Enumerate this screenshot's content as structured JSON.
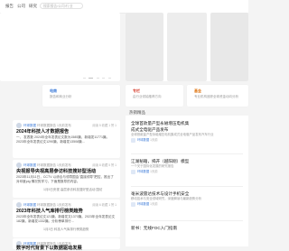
{
  "nav": {
    "items": [
      "报告",
      "公司",
      "研究"
    ],
    "search_placeholder": "搜索报告/公司/行业"
  },
  "banner": {
    "dots": 5,
    "active_dot": 1
  },
  "cards": [
    {
      "tag": "电商",
      "sub": "报告和商业分析",
      "color": "#3b7ad8",
      "sub_color": "#999999"
    },
    {
      "tag": "专栏",
      "sub": "由行业领袖推荐方向",
      "color": "#d84a3a",
      "sub_color": "#999999"
    },
    {
      "tag": "基金",
      "sub": "专业机构追踪全球资金动向分析",
      "color": "#e07a1a",
      "sub_color": "#999999"
    }
  ],
  "left_section": {
    "title": ""
  },
  "feed": [
    {
      "source": "环球数据",
      "meta": "环球数据报告 1天前发布",
      "stats": "阅读 5  收藏 1  赞 1",
      "title": "2024年科技人才数据报告",
      "summary": "一、 发表数 2024年全年发表论文数为1585篇，新增发11771篇。2023年全年发表论文1290篇，新增发13508篇...",
      "extra": ""
    },
    {
      "source": "环球数据",
      "meta": "环球数据报告 1天前发布",
      "stats": "阅读 8  收藏 5  赞 1",
      "title": "央视报导央视高层参访科技搜好型活动",
      "summary": "2023年11月11日，CCTV 以综合与领导国会\"直接领导\"把控，推出了对印度pig 情况的学习，下面是报导的内容。",
      "extra": "1月5日央视 高层参访科技搜好型活动 国访"
    },
    {
      "source": "环球数据",
      "meta": "环球数据报告 1天前发布",
      "stats": "阅读 6  收藏 1  赞 1",
      "title": "2023年科技人气库排行榜类趋势",
      "summary": "2023年全年发表论文121篇，新增发文1370篇。2023年全年发表论文182篇，新增发1332篇。分析榜单排行...",
      "extra": "1月3日 科技人气库排行榜类趋势"
    },
    {
      "source": "环球数据",
      "meta": "环球数据报告 1天前发布",
      "stats": "阅读 4  收藏 2  赞 1",
      "title": "数字时代背景下以数据驱动发展",
      "summary": "",
      "extra": ""
    }
  ],
  "right_section": {
    "title": "热销精品"
  },
  "right_list": [
    {
      "title": "全球首款量产型永磁增压电机集",
      "line2": "成式全电驱产品发布",
      "summary": "全球首款量产型永磁增压电机集成式全电驱产品发布汽车行业",
      "meta_src": "环球数据",
      "meta": "1天前"
    },
    {
      "title": "江湖秘籍，揭开（越阳刚）模型",
      "line2": "",
      "summary": "一个关于国际化发展的研究报告",
      "meta_src": "环球数据",
      "meta": "1天前"
    },
    {
      "title": "毫米波雷达技术与设计手机安全",
      "line2": "",
      "summary": "移动技术与安全领域研究，深度解读与最新趋势分析",
      "meta_src": "环球数据",
      "meta": "1天前"
    },
    {
      "title": "新书：无线FOC入门指南",
      "line2": "",
      "summary": "",
      "meta_src": "",
      "meta": ""
    }
  ]
}
